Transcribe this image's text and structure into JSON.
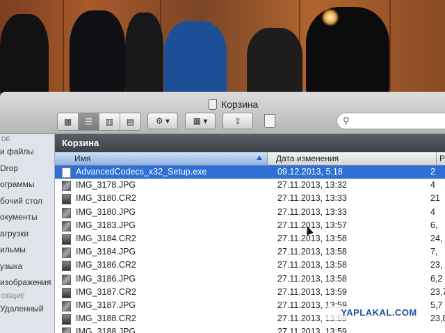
{
  "window": {
    "title": "Корзина"
  },
  "toolbar": {
    "view_buttons": [
      "icon-view",
      "list-view",
      "column-view",
      "coverflow-view"
    ],
    "action_icon": "gear-icon",
    "arrange_icon": "grid-arrange-icon",
    "share_icon": "share-icon",
    "empty_trash_icon": "trash-icon",
    "search_icon": "search-icon"
  },
  "sidebar": {
    "section_devices": "DE",
    "items": [
      "и файлы",
      "Drop",
      "ограммы",
      "бочий стол",
      "окументы",
      "агрузки",
      "ильмы",
      "узыка",
      "изображения"
    ],
    "section_shared": "ОБЩИЕ",
    "shared_items": [
      "Удаленный"
    ]
  },
  "pathbar": {
    "label": "Корзина"
  },
  "columns": {
    "name": "Имя",
    "date": "Дата изменения",
    "size": "Р"
  },
  "files": [
    {
      "name": "AdvancedCodecs_x32_Setup.exe",
      "date": "09.12.2013, 5:18",
      "size": "2",
      "type": "exe",
      "selected": true
    },
    {
      "name": "IMG_3178.JPG",
      "date": "27.11.2013, 13:32",
      "size": "4",
      "type": "jpg"
    },
    {
      "name": "IMG_3180.CR2",
      "date": "27.11.2013, 13:33",
      "size": "21",
      "type": "cr2"
    },
    {
      "name": "IMG_3180.JPG",
      "date": "27.11.2013, 13:33",
      "size": "4",
      "type": "jpg"
    },
    {
      "name": "IMG_3183.JPG",
      "date": "27.11.2013, 13:57",
      "size": "6,",
      "type": "jpg"
    },
    {
      "name": "IMG_3184.CR2",
      "date": "27.11.2013, 13:58",
      "size": "24,",
      "type": "cr2"
    },
    {
      "name": "IMG_3184.JPG",
      "date": "27.11.2013, 13:58",
      "size": "7,",
      "type": "jpg"
    },
    {
      "name": "IMG_3186.CR2",
      "date": "27.11.2013, 13:58",
      "size": "23,",
      "type": "cr2"
    },
    {
      "name": "IMG_3186.JPG",
      "date": "27.11.2013, 13:58",
      "size": "6,2",
      "type": "jpg"
    },
    {
      "name": "IMG_3187.CR2",
      "date": "27.11.2013, 13:59",
      "size": "23,7",
      "type": "cr2"
    },
    {
      "name": "IMG_3187.JPG",
      "date": "27.11.2013, 13:59",
      "size": "5,7",
      "type": "jpg"
    },
    {
      "name": "IMG_3188.CR2",
      "date": "27.11.2013, 13:59",
      "size": "23,8",
      "type": "cr2"
    },
    {
      "name": "IMG_3188.JPG",
      "date": "27.11.2013, 13:59",
      "size": "",
      "type": "jpg"
    }
  ],
  "watermark": "YAPLAKAL.COM",
  "colors": {
    "selection": "#2f6fd6",
    "pathbar": "#4a4f55",
    "sidebar": "#dfe4ea"
  }
}
